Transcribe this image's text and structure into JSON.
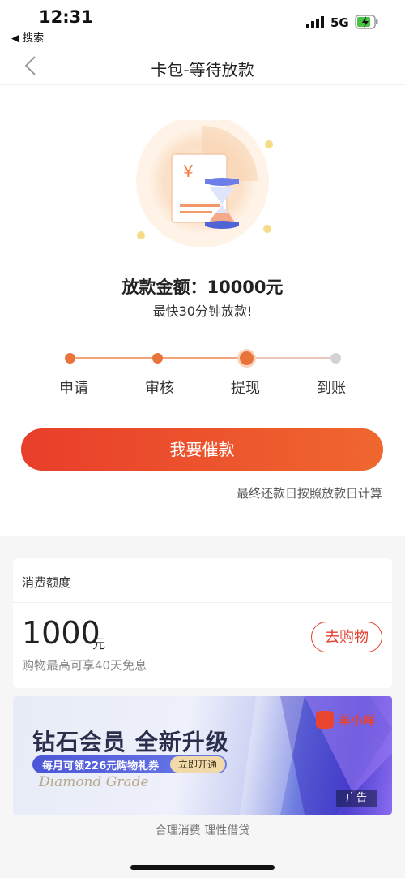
{
  "status_bar": {
    "time": "12:31",
    "back_app": "◀ 搜索",
    "network": "5G",
    "icons": [
      "signal-icon",
      "battery-charging-icon"
    ]
  },
  "nav": {
    "back_icon": "chevron-left-icon",
    "title": "卡包-等待放款"
  },
  "hero": {
    "illustration": "receipt-hourglass-illustration",
    "currency_symbol": "¥",
    "amount_text": "放款金额：10000元",
    "subtitle": "最快30分钟放款!"
  },
  "steps": [
    {
      "label": "申请",
      "state": "done"
    },
    {
      "label": "审核",
      "state": "done"
    },
    {
      "label": "提现",
      "state": "current"
    },
    {
      "label": "到账",
      "state": "pending"
    }
  ],
  "actions": {
    "urge_label": "我要催款",
    "repay_note": "最终还款日按照放款日计算"
  },
  "credit": {
    "title": "消费额度",
    "amount": "1000",
    "unit": "元",
    "description": "购物最高可享40天免息",
    "shop_label": "去购物"
  },
  "ad": {
    "title": "钻石会员  全新升级",
    "offer": "每月可领226元购物礼券",
    "cta": "立即开通",
    "script_text": "Diamond Grade",
    "brand": "羊小咩",
    "tag": "广告"
  },
  "footer": {
    "slogan": "合理消费 理性借贷"
  },
  "colors": {
    "accent": "#e8743b",
    "button_start": "#e83e2a",
    "button_end": "#f0672f",
    "pending": "#d2d2d2"
  }
}
